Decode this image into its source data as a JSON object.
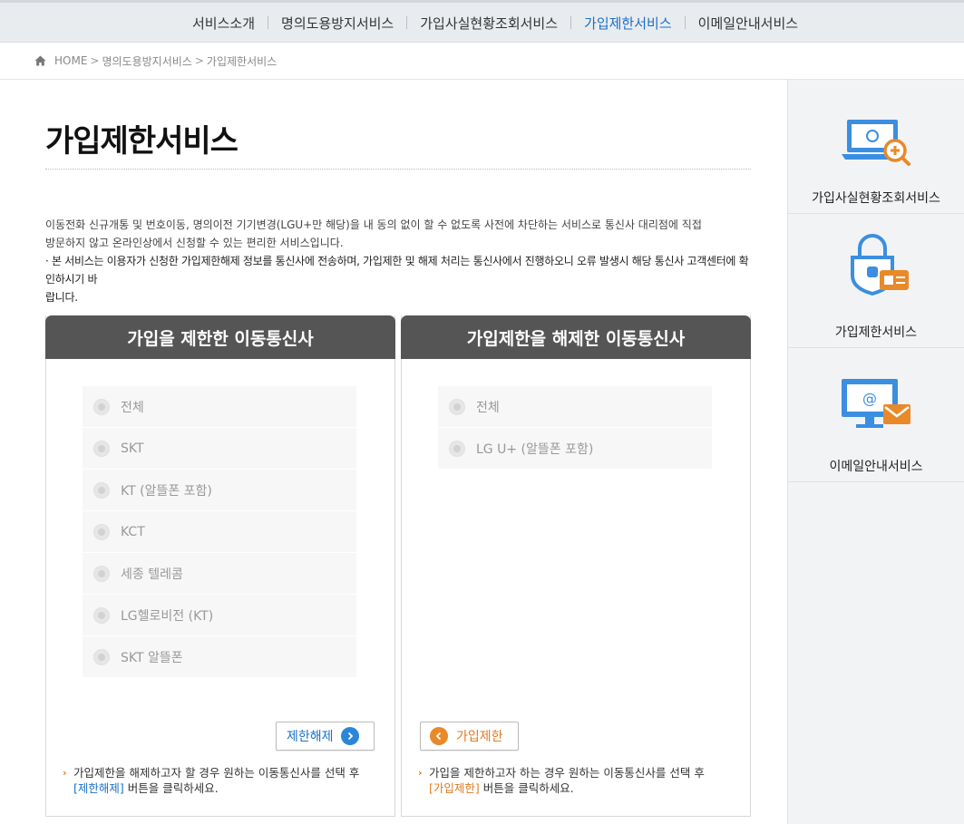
{
  "topnav": {
    "items": [
      {
        "label": "서비스소개"
      },
      {
        "label": "명의도용방지서비스"
      },
      {
        "label": "가입사실현황조회서비스"
      },
      {
        "label": "가입제한서비스"
      },
      {
        "label": "이메일안내서비스"
      }
    ],
    "active_index": 3
  },
  "breadcrumb": {
    "home": "HOME",
    "level1": "명의도용방지서비스",
    "level2": "가입제한서비스",
    "separator": ">"
  },
  "page": {
    "title": "가입제한서비스",
    "description_line1": "이동전화 신규개통 및 번호이동, 명의이전 기기변경(LGU+만 해당)을 내 동의 없이 할 수 없도록 사전에 차단하는 서비스로 통신사 대리점에 직접",
    "description_line2": "방문하지 않고 온라인상에서 신청할 수 있는 편리한 서비스입니다.",
    "note_line1": "· 본 서비스는 이용자가 신청한 가입제한해제 정보를 통신사에 전송하며, 가입제한 및 해제 처리는 통신사에서 진행하오니 오류 발생시 해당 통신사 고객센터에 확인하시기 바",
    "note_line2": "랍니다."
  },
  "left_panel": {
    "title": "가입을 제한한 이동통신사",
    "options": [
      "전체",
      "SKT",
      "KT (알뜰폰 포함)",
      "KCT",
      "세종 텔레콤",
      "LG헬로비전 (KT)",
      "SKT 알뜰폰"
    ],
    "button_label": "제한해제",
    "hint_caret": "›",
    "hint_text1": "가입제한을 해제하고자 할 경우 원하는 이동통신사를 선택 후",
    "hint_link": "[제한해제]",
    "hint_text2": "버튼을 클릭하세요."
  },
  "right_panel": {
    "title": "가입제한을 해제한 이동통신사",
    "options": [
      "전체",
      "LG U+ (알뜰폰 포함)"
    ],
    "button_label": "가입제한",
    "hint_caret": "›",
    "hint_text1": "가입을 제한하고자 하는 경우 원하는 이동통신사를 선택 후",
    "hint_link": "[가입제한]",
    "hint_text2": "버튼을 클릭하세요."
  },
  "sidebar": {
    "items": [
      {
        "label": "가입사실현황조회서비스",
        "icon": "laptop-search-icon"
      },
      {
        "label": "가입제한서비스",
        "icon": "lock-card-icon"
      },
      {
        "label": "이메일안내서비스",
        "icon": "monitor-mail-icon"
      }
    ]
  },
  "colors": {
    "accent_blue": "#1a6fc9",
    "accent_orange": "#e8892a",
    "panel_header": "#555555",
    "icon_blue": "#3b8ee0"
  }
}
